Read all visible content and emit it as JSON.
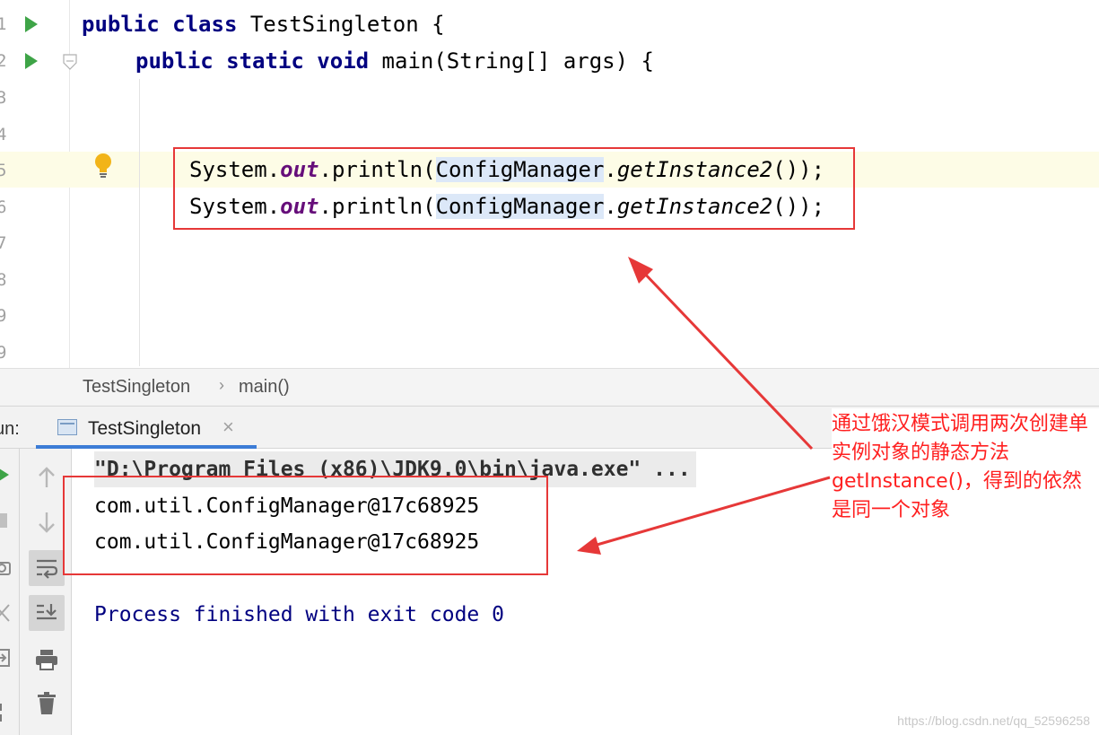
{
  "editor": {
    "line_numbers": [
      "1",
      "2",
      "3",
      "4",
      "5",
      "6",
      "7",
      "8",
      "9",
      "9"
    ],
    "lines": {
      "l1_kw": "public class",
      "l1_rest": " TestSingleton {",
      "l2_kw": "public static void",
      "l2_rest": " main(String[] args) {",
      "l5_a": "System.",
      "l5_out": "out",
      "l5_b": ".println(",
      "l5_cls": "ConfigManager",
      "l5_c": ".",
      "l5_m": "getInstance2",
      "l5_d": "());",
      "l6_a": "System.",
      "l6_out": "out",
      "l6_b": ".println(",
      "l6_cls": "ConfigManager",
      "l6_c": ".",
      "l6_m": "getInstance2",
      "l6_d": "());"
    }
  },
  "breadcrumb": {
    "class_name": "TestSingleton",
    "separator": "›",
    "method_name": "main()"
  },
  "run_panel": {
    "label": "un:",
    "tab_label": "TestSingleton",
    "tab_close": "×",
    "console": {
      "command": "\"D:\\Program Files (x86)\\JDK9.0\\bin\\java.exe\" ...",
      "output_1": "com.util.ConfigManager@17c68925",
      "output_2": "com.util.ConfigManager@17c68925",
      "exit": "Process finished with exit code 0"
    }
  },
  "annotation": {
    "text": "通过饿汉模式调用两次创建单实例对象的静态方法getInstance()，得到的依然是同一个对象"
  },
  "watermark": "https://blog.csdn.net/qq_52596258",
  "colors": {
    "annotation_red": "#e63838",
    "keyword": "#000080",
    "field": "#660e7a",
    "run_green": "#3ea447",
    "tab_underline": "#3c7cd6"
  },
  "icons": [
    "run-icon",
    "fold-icon",
    "lightbulb-icon",
    "rerun-up-icon",
    "rerun-down-icon",
    "soft-wrap-icon",
    "scroll-to-end-icon",
    "print-icon",
    "trash-icon",
    "console-tab-icon",
    "close-icon"
  ]
}
